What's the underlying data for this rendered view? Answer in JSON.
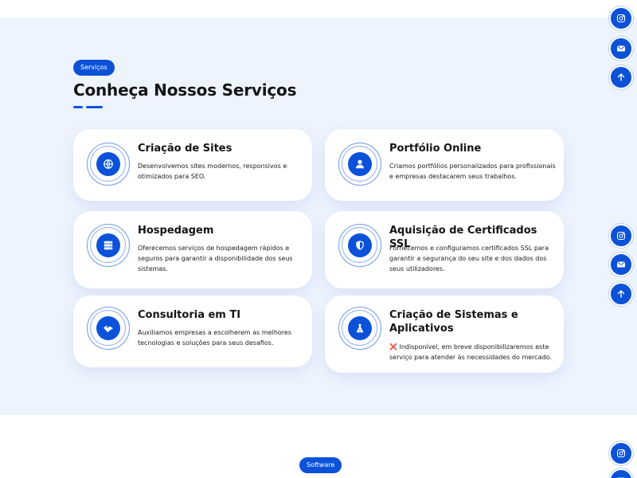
{
  "section": {
    "badge": "Serviços",
    "title": "Conheça Nossos Serviços"
  },
  "services": [
    {
      "title": "Criação de Sites",
      "description": "Desenvolvemos sites modernos, responsivos e otimizados para SEO.",
      "icon": "globe-icon"
    },
    {
      "title": "Portfólio Online",
      "description": "Criamos portfólios personalizados para profissionais e empresas destacarem seus trabalhos.",
      "icon": "user-icon"
    },
    {
      "title": "Hospedagem",
      "description": "Oferecemos serviços de hospedagem rápidos e seguros para garantir a disponibilidade dos seus sistemas.",
      "icon": "server-icon"
    },
    {
      "title": "Aquisição de Certificados SSL",
      "description": "Fornecemos e configuramos certificados SSL para garantir a segurança do seu site e dos dados dos seus utilizadores.",
      "icon": "shield-icon"
    },
    {
      "title": "Consultoria em TI",
      "description": "Auxiliamos empresas a escolherem as melhores tecnologias e soluções para seus desafios.",
      "icon": "handshake-icon"
    },
    {
      "title": "Criação de Sistemas e Aplicativos",
      "description": "❌ Indisponível, em breve disponibilizaremos este serviço para atender às necessidades do mercado.",
      "icon": "flask-icon"
    }
  ],
  "next_section": {
    "badge": "Software"
  },
  "floating_actions": [
    "instagram-icon",
    "mail-icon",
    "arrow-up-icon"
  ],
  "colors": {
    "accent": "#0b52d9",
    "section_background": "#eef4fe",
    "card_background": "#ffffff"
  }
}
